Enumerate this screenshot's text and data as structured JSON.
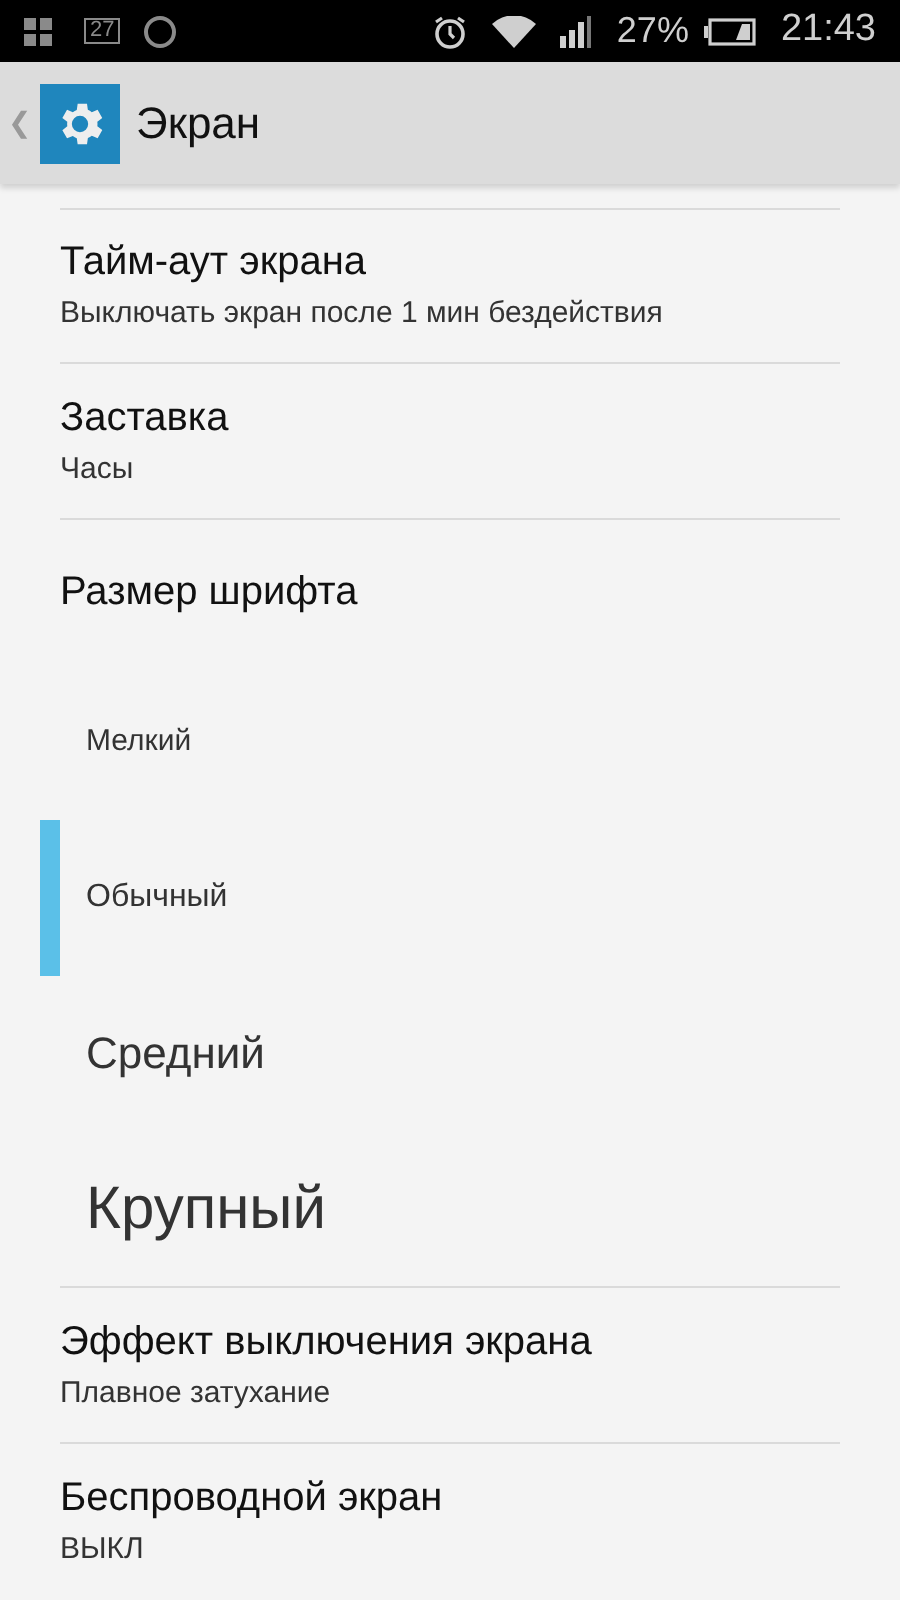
{
  "status_bar": {
    "notification_count": "27",
    "battery": "27%",
    "time": "21:43"
  },
  "header": {
    "back": "❮",
    "title": "Экран"
  },
  "settings_before": [
    {
      "title": "Тайм-аут экрана",
      "summary": "Выключать экран после 1 мин бездействия"
    },
    {
      "title": "Заставка",
      "summary": "Часы"
    }
  ],
  "font_size": {
    "title": "Размер шрифта",
    "options": [
      {
        "label": "Мелкий",
        "kind": "small",
        "selected": false
      },
      {
        "label": "Обычный",
        "kind": "normal",
        "selected": true
      },
      {
        "label": "Средний",
        "kind": "medium",
        "selected": false
      },
      {
        "label": "Крупный",
        "kind": "large",
        "selected": false
      }
    ]
  },
  "settings_after": [
    {
      "title": "Эффект выключения экрана",
      "summary": "Плавное затухание"
    },
    {
      "title": "Беспроводной экран",
      "summary": "ВЫКЛ"
    }
  ]
}
